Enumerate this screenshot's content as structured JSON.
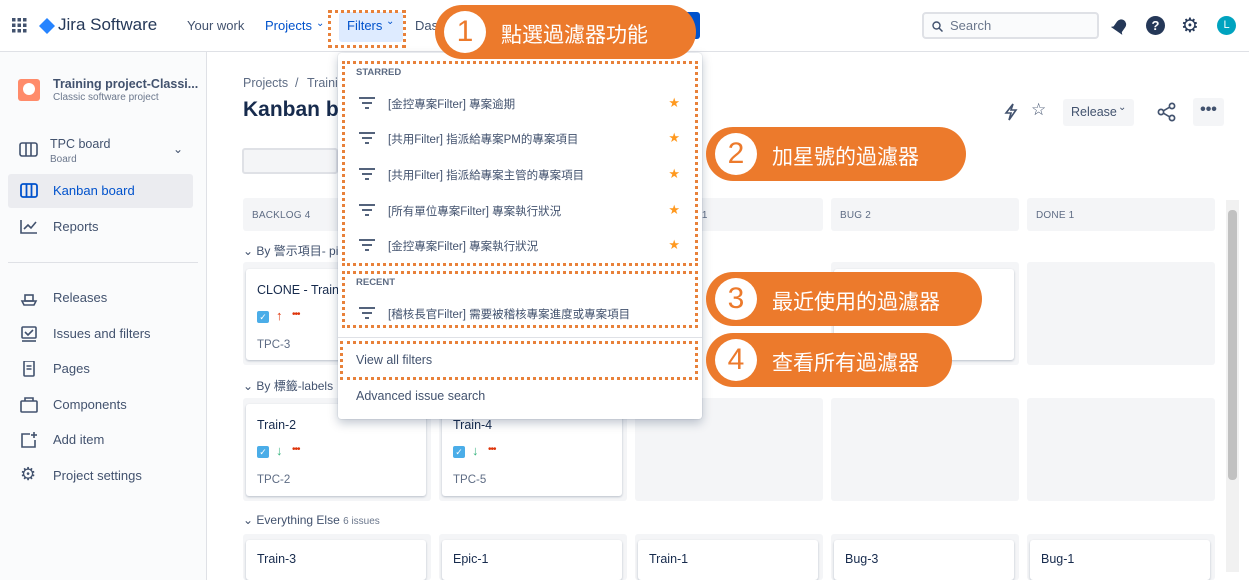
{
  "topnav": {
    "logo_text": "Jira Software",
    "items": [
      "Your work",
      "Projects",
      "Filters",
      "Das"
    ],
    "search_placeholder": "Search",
    "avatar_letter": "L",
    "colors": {
      "brand": "#0052cc",
      "avatar": "#00a3bf"
    }
  },
  "sidebar": {
    "project_name": "Training project-Classi...",
    "project_type": "Classic software project",
    "board_name": "TPC board",
    "board_sub": "Board",
    "items": [
      {
        "label": "Kanban board",
        "icon": "board-icon"
      },
      {
        "label": "Reports",
        "icon": "chart-icon"
      },
      {
        "label": "Releases",
        "icon": "ship-icon"
      },
      {
        "label": "Issues and filters",
        "icon": "issues-icon"
      },
      {
        "label": "Pages",
        "icon": "page-icon"
      },
      {
        "label": "Components",
        "icon": "component-icon"
      },
      {
        "label": "Add item",
        "icon": "add-item-icon"
      },
      {
        "label": "Project settings",
        "icon": "gear-icon"
      }
    ]
  },
  "main": {
    "breadcrumb": [
      "Projects",
      "/",
      "Traini"
    ],
    "title": "Kanban bo",
    "release_label": "Release",
    "columns": [
      "BACKLOG 4",
      "S 1",
      "BUG 2",
      "DONE 1"
    ],
    "swimlanes": [
      {
        "label": "By 警示項目- pi"
      },
      {
        "label": "By 標籤-labels"
      },
      {
        "label": "Everything Else",
        "count": "6 issues"
      }
    ],
    "cards": [
      {
        "title": "CLONE - Train-",
        "key": "TPC-3",
        "arrow": "↑"
      },
      {
        "title": "Train-2",
        "key": "TPC-2",
        "arrow": "↓"
      },
      {
        "title": "Train-4",
        "key": "TPC-5",
        "arrow": "↓"
      },
      {
        "title": "Train-3"
      },
      {
        "title": "Epic-1"
      },
      {
        "title": "Train-1"
      },
      {
        "title": "Bug-3"
      },
      {
        "title": "Bug-1"
      }
    ]
  },
  "dropdown": {
    "starred_header": "STARRED",
    "starred": [
      "[金控專案Filter] 專案逾期",
      "[共用Filter] 指派給專案PM的專案項目",
      "[共用Filter] 指派給專案主管的專案項目",
      "[所有單位專案Filter] 專案執行狀況",
      "[金控專案Filter] 專案執行狀況"
    ],
    "recent_header": "RECENT",
    "recent": [
      "[稽核長官Filter] 需要被稽核專案進度或專案項目"
    ],
    "view_all": "View all filters",
    "advanced": "Advanced issue search"
  },
  "annotations": [
    {
      "num": "1",
      "text": "點選過濾器功能"
    },
    {
      "num": "2",
      "text": "加星號的過濾器"
    },
    {
      "num": "3",
      "text": "最近使用的過濾器"
    },
    {
      "num": "4",
      "text": "查看所有過濾器"
    }
  ],
  "annotation_color": "#ec7a2c"
}
